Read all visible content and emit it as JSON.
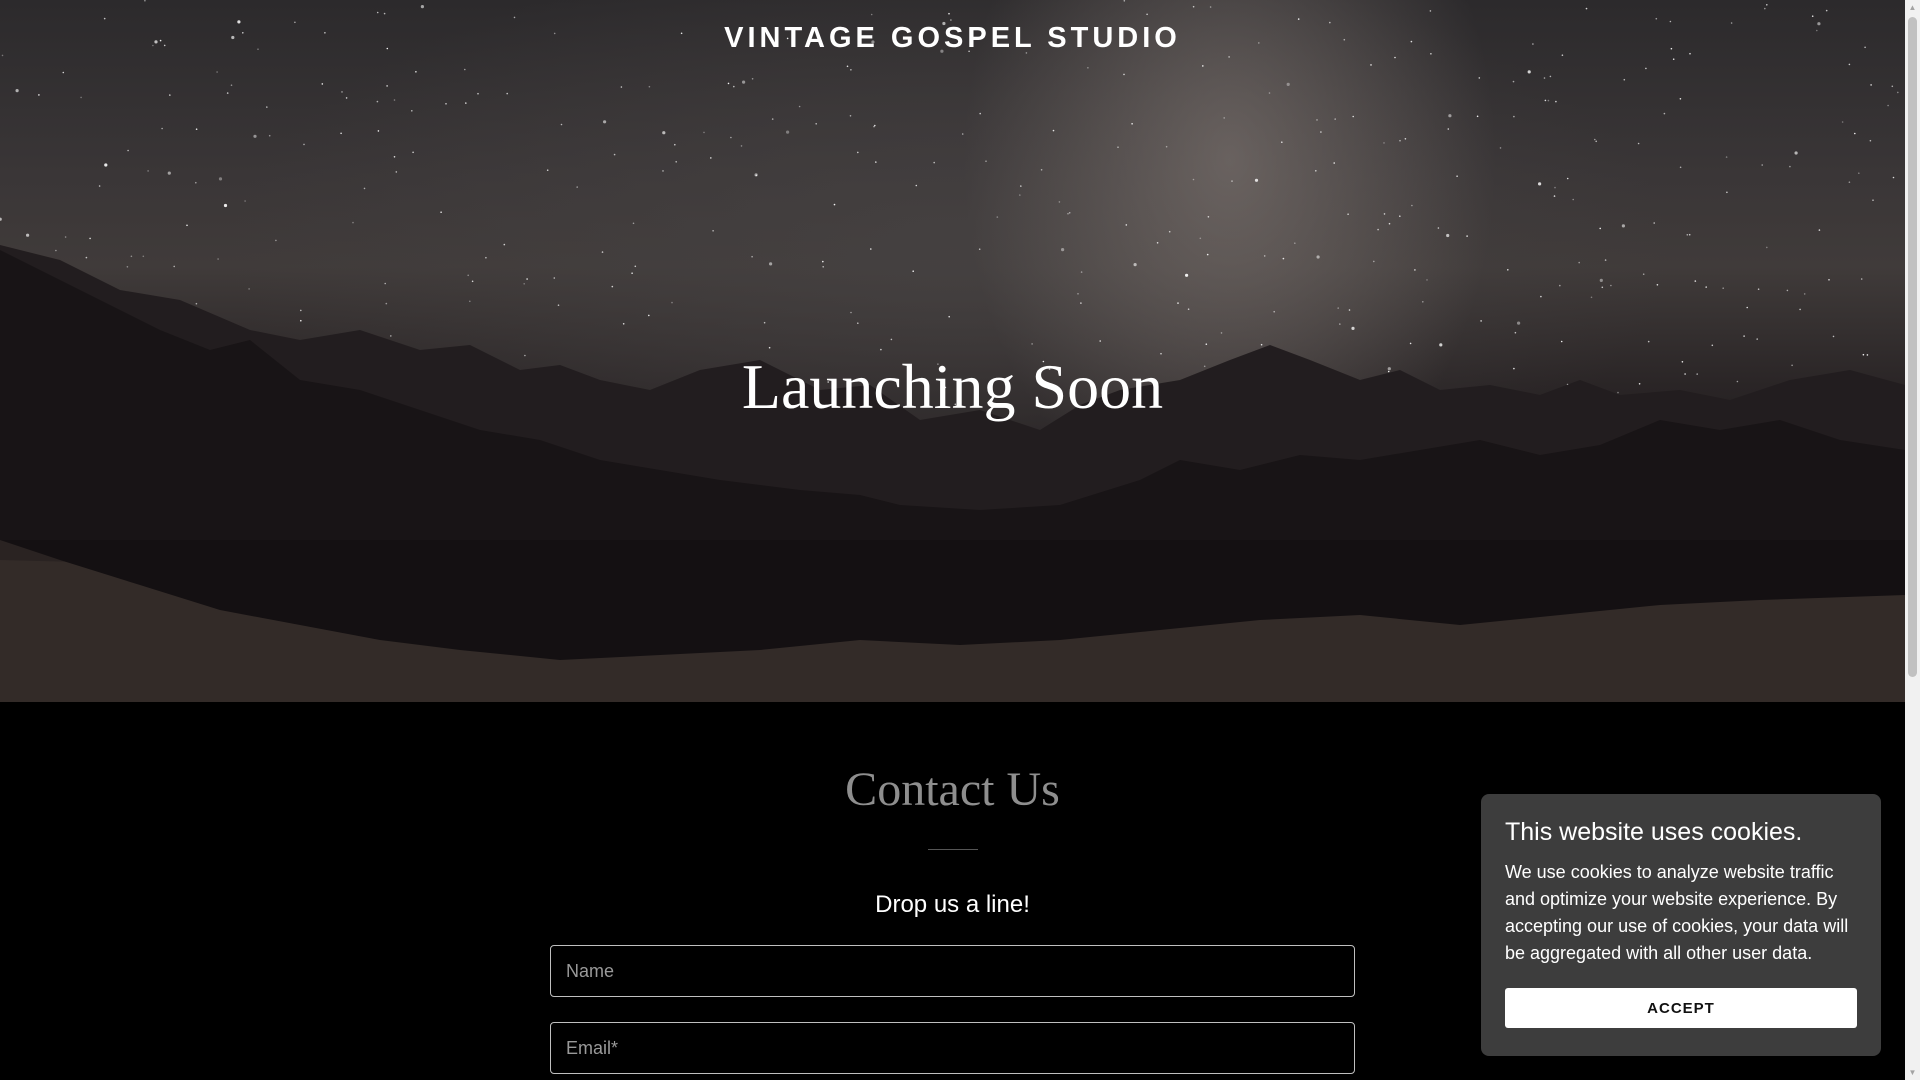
{
  "header": {
    "brand": "VINTAGE GOSPEL STUDIO"
  },
  "hero": {
    "headline": "Launching Soon"
  },
  "contact": {
    "title": "Contact Us",
    "subtitle": "Drop us a line!",
    "name_placeholder": "Name",
    "email_placeholder": "Email*"
  },
  "cookie_banner": {
    "title": "This website uses cookies.",
    "body": "We use cookies to analyze website traffic and optimize your website experience. By accepting our use of cookies, your data will be aggregated with all other user data.",
    "accept_label": "ACCEPT"
  },
  "icons": {
    "scroll_up": "scroll-up-arrow-icon",
    "scroll_down": "scroll-down-arrow-icon"
  },
  "colors": {
    "page_background": "#000000",
    "cookie_background": "#3d3d3d",
    "contact_title": "#8e8e8e",
    "accept_button": "#ffffff"
  }
}
